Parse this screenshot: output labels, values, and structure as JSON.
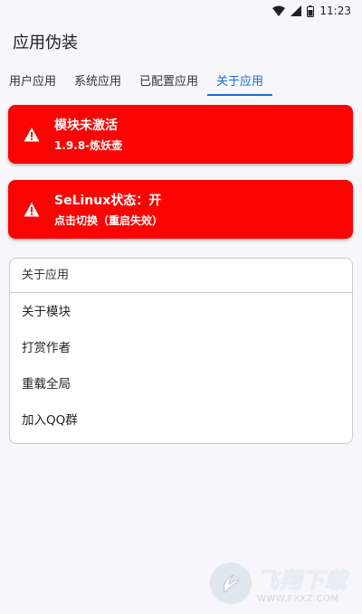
{
  "status_bar": {
    "time": "11:23"
  },
  "app": {
    "title": "应用伪装"
  },
  "tabs": [
    {
      "label": "用户应用",
      "active": false
    },
    {
      "label": "系统应用",
      "active": false
    },
    {
      "label": "已配置应用",
      "active": false
    },
    {
      "label": "关于应用",
      "active": true
    }
  ],
  "alerts": [
    {
      "title": "模块未激活",
      "subtitle": "1.9.8-炼妖壶",
      "color": "#fc0303"
    },
    {
      "title": "SeLinux状态：开",
      "subtitle": "点击切换（重启失效）",
      "color": "#fc0303"
    }
  ],
  "about": {
    "header": "关于应用",
    "items": [
      "关于模块",
      "打赏作者",
      "重载全局",
      "加入QQ群"
    ]
  },
  "watermark": {
    "brand": "飞翔下载",
    "url": "WWW.FXXZ.COM"
  },
  "accent": "#1a6fcf"
}
